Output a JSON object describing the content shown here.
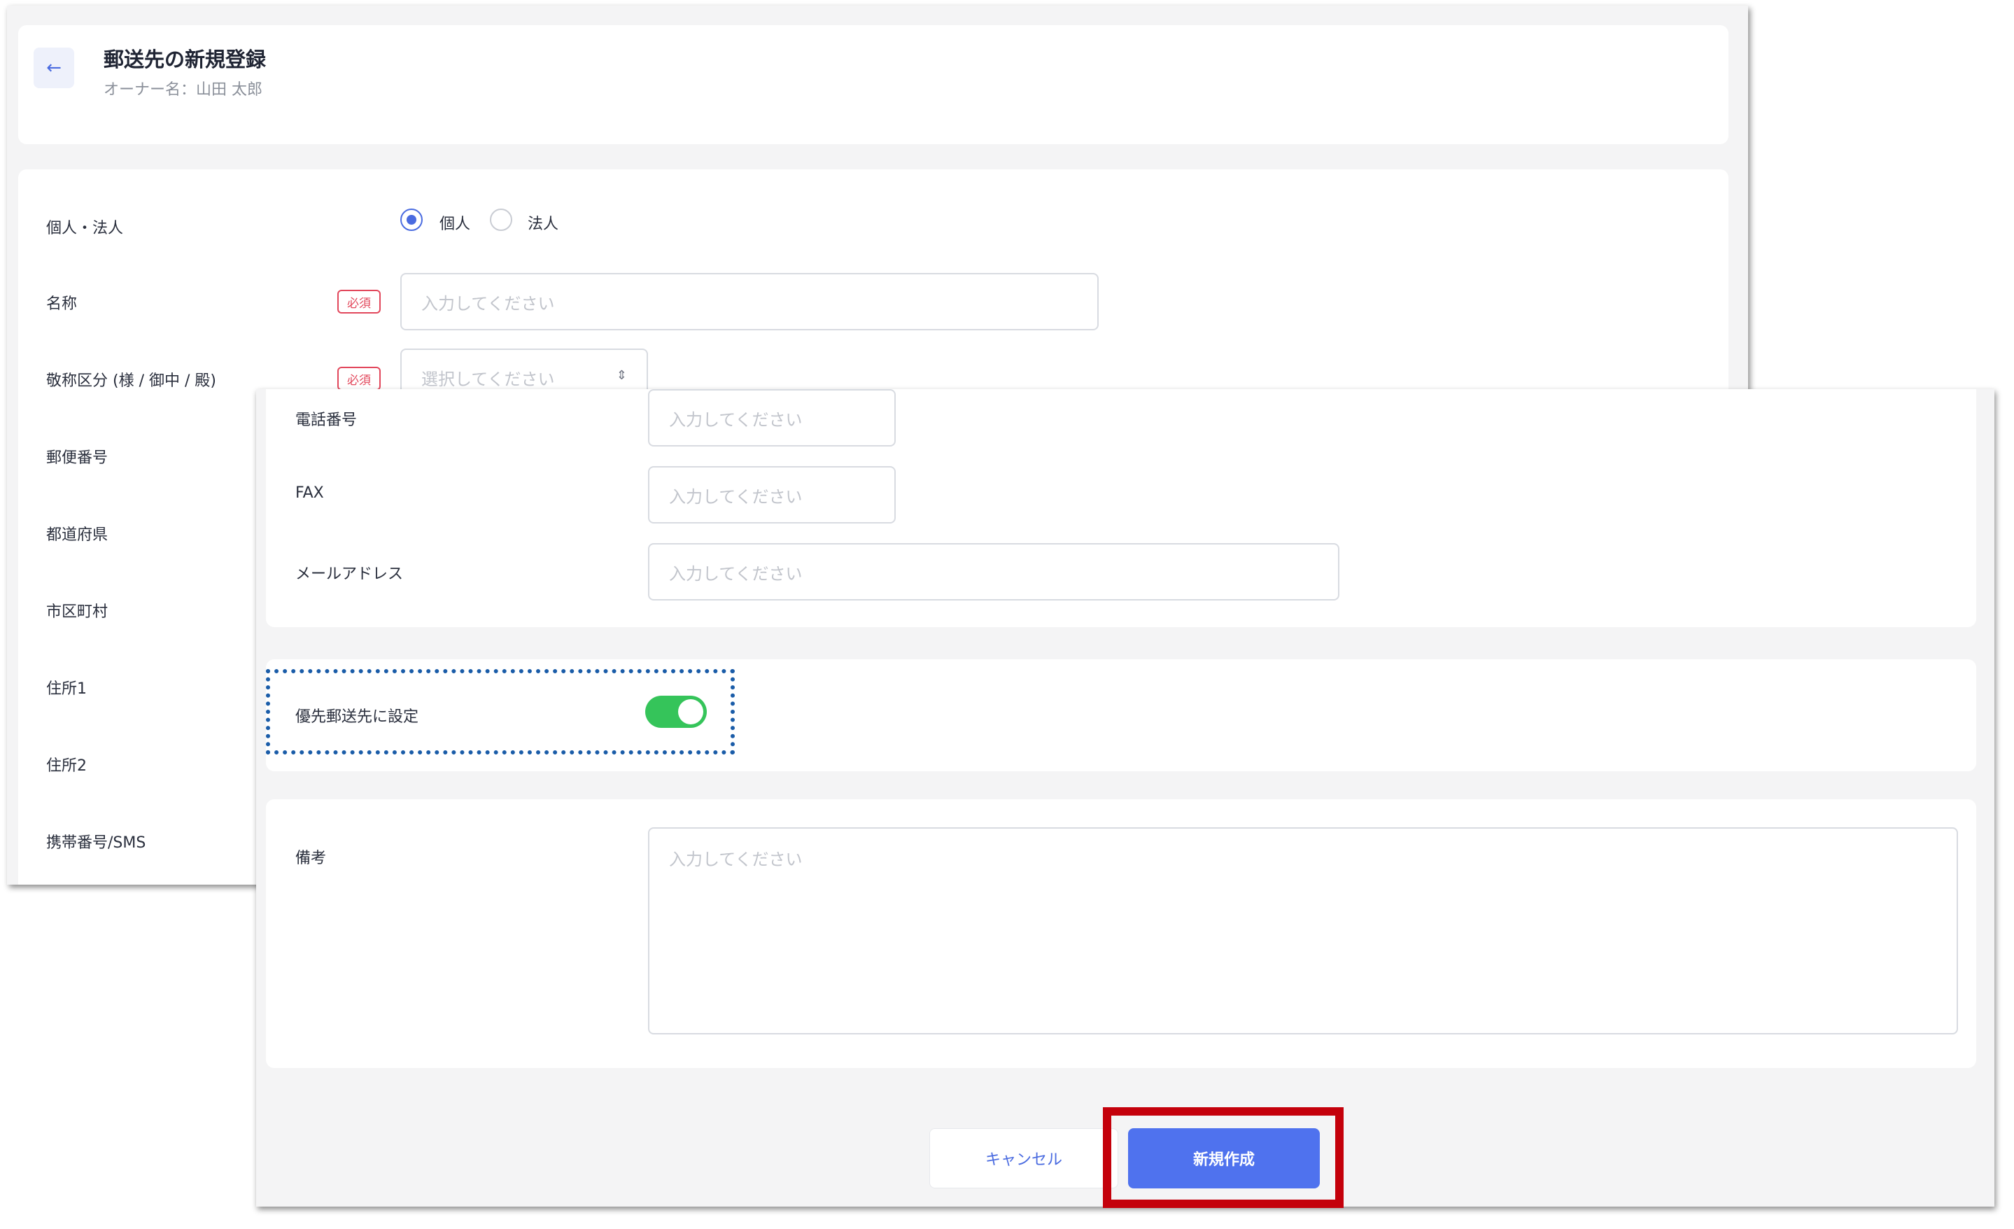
{
  "header": {
    "back_icon": "arrow-left-icon",
    "title": "郵送先の新規登録",
    "owner_line": "オーナー名：山田 太郎"
  },
  "form": {
    "entity_type": {
      "label": "個人・法人",
      "options": [
        "個人",
        "法人"
      ],
      "selected": "個人"
    },
    "required_badge": "必須",
    "name": {
      "label": "名称",
      "placeholder": "入力してください"
    },
    "honorific": {
      "label": "敬称区分 (様 / 御中 / 殿)",
      "placeholder": "選択してください"
    },
    "postal_code": {
      "label": "郵便番号"
    },
    "prefecture": {
      "label": "都道府県"
    },
    "city": {
      "label": "市区町村"
    },
    "address1": {
      "label": "住所1"
    },
    "address2": {
      "label": "住所2"
    },
    "mobile": {
      "label": "携帯番号/SMS"
    },
    "phone": {
      "label": "電話番号",
      "placeholder": "入力してください"
    },
    "fax": {
      "label": "FAX",
      "placeholder": "入力してください"
    },
    "email": {
      "label": "メールアドレス",
      "placeholder": "入力してください"
    },
    "priority": {
      "label": "優先郵送先に設定",
      "enabled": true
    },
    "notes": {
      "label": "備考",
      "placeholder": "入力してください"
    }
  },
  "actions": {
    "cancel_label": "キャンセル",
    "create_label": "新規作成"
  },
  "colors": {
    "accent": "#4f72ee",
    "required": "#e2475b",
    "toggle_on": "#35c45a",
    "annotation_dotted": "#1a5ca8",
    "annotation_highlight": "#c4000b"
  }
}
